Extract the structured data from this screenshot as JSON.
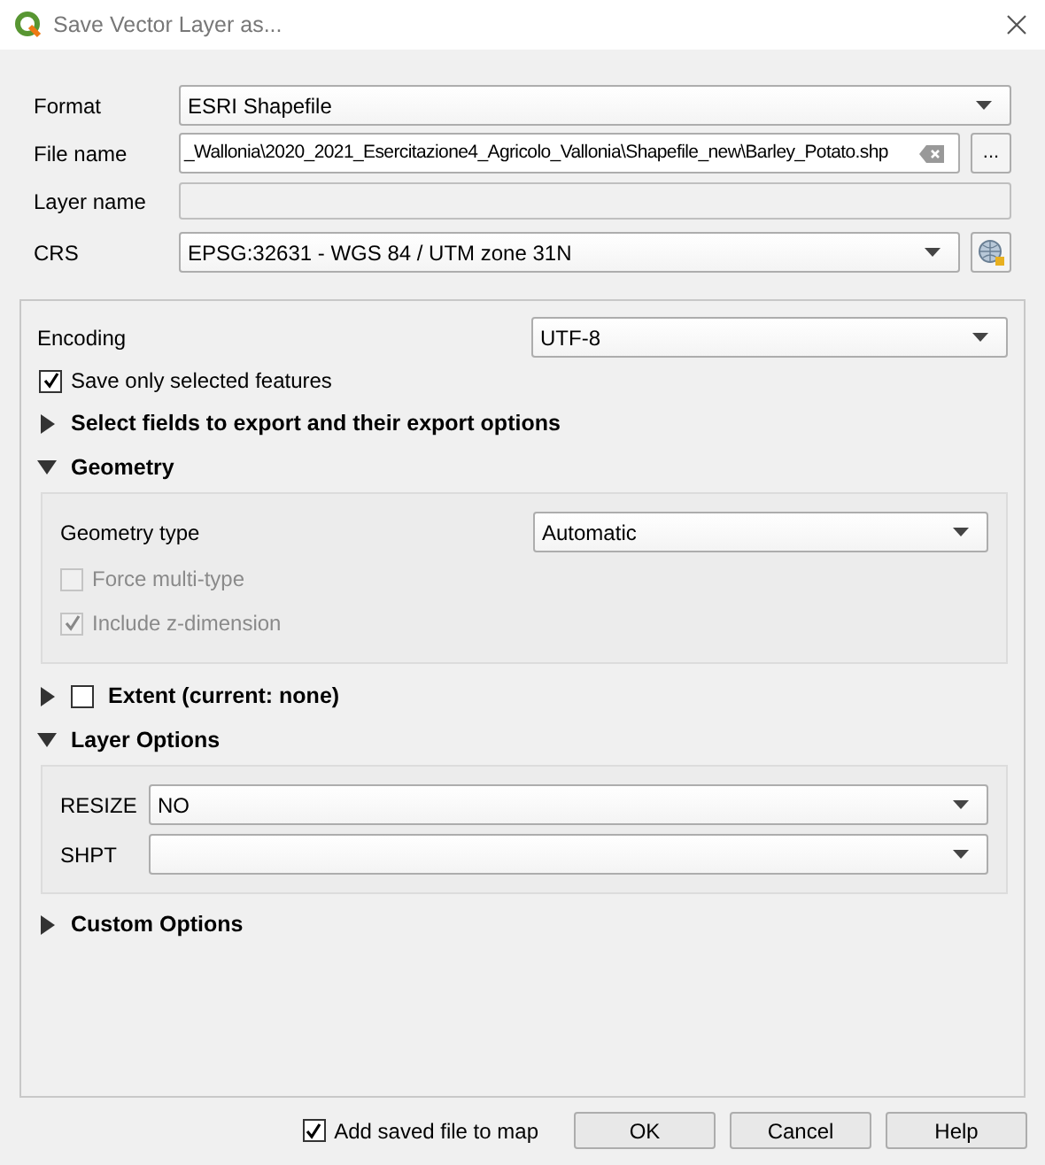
{
  "window": {
    "title": "Save Vector Layer as..."
  },
  "format": {
    "label": "Format",
    "value": "ESRI Shapefile"
  },
  "file_name": {
    "label": "File name",
    "value": "_Wallonia\\2020_2021_Esercitazione4_Agricolo_Vallonia\\Shapefile_new\\Barley_Potato.shp",
    "browse": "..."
  },
  "layer_name": {
    "label": "Layer name",
    "disabled": true
  },
  "crs": {
    "label": "CRS",
    "value": "EPSG:32631 - WGS 84 / UTM zone 31N"
  },
  "encoding": {
    "label": "Encoding",
    "value": "UTF-8"
  },
  "save_selected": {
    "label": "Save only selected features",
    "checked": true
  },
  "fields_section": {
    "title": "Select fields to export and their export options",
    "expanded": false
  },
  "geometry": {
    "title": "Geometry",
    "expanded": true,
    "geometry_type": {
      "label": "Geometry type",
      "value": "Automatic"
    },
    "options": [
      {
        "label": "Force multi-type",
        "checked": false,
        "disabled": true
      },
      {
        "label": "Include z-dimension",
        "checked": true,
        "disabled": true
      }
    ]
  },
  "extent": {
    "title": "Extent (current: none)",
    "expanded": false,
    "checked": false
  },
  "layer_options": {
    "title": "Layer Options",
    "expanded": true,
    "options": [
      {
        "label": "RESIZE",
        "value": "NO"
      },
      {
        "label": "SHPT"
      }
    ]
  },
  "custom_options": {
    "title": "Custom Options",
    "expanded": false
  },
  "add_to_map": {
    "label": "Add saved file to map",
    "checked": true
  },
  "buttons": [
    "OK",
    "Cancel",
    "Help"
  ]
}
